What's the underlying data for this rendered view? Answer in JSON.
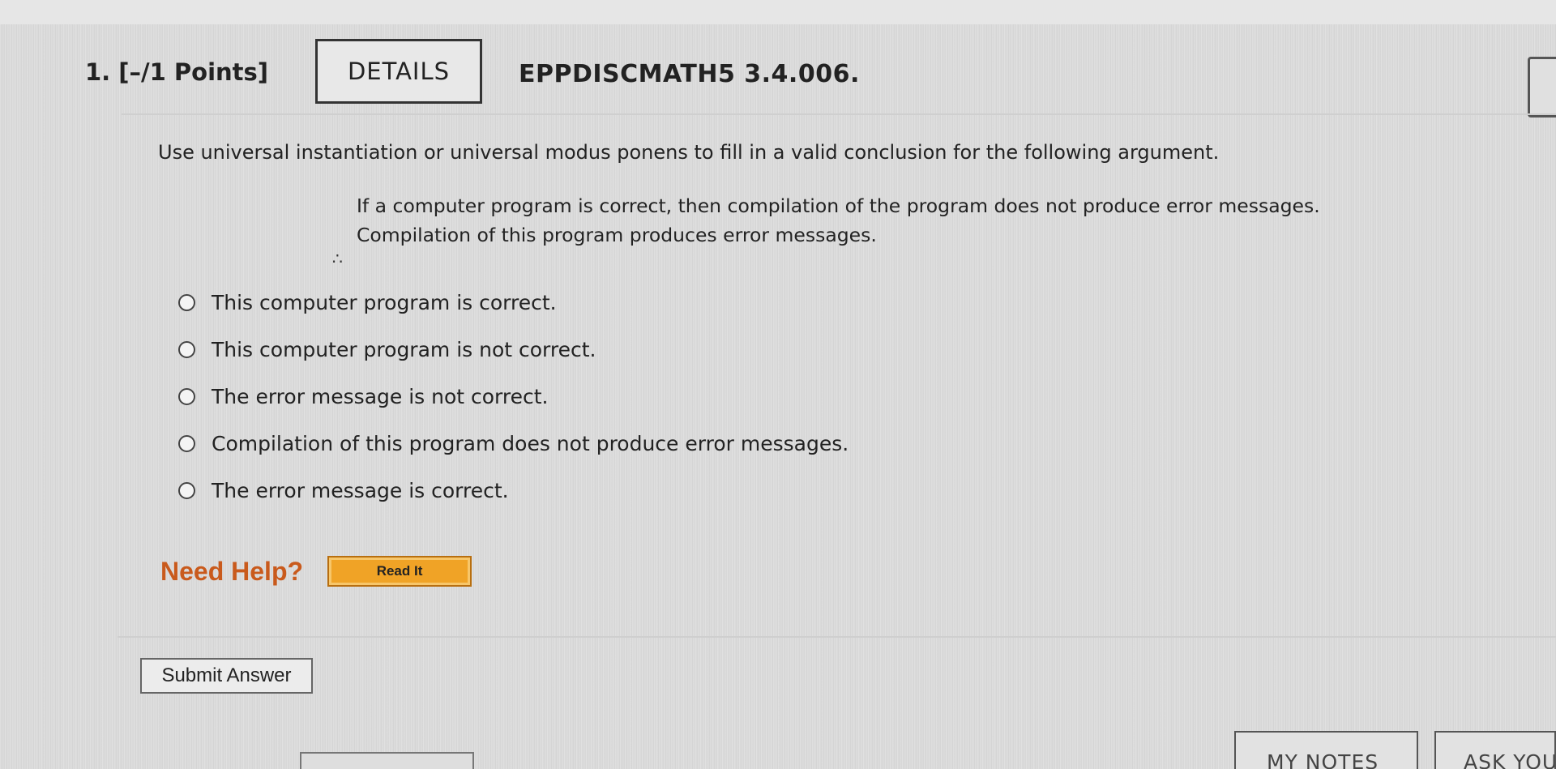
{
  "question": {
    "number_points": "1.  [–/1 Points]",
    "details_label": "DETAILS",
    "code": "EPPDISCMATH5 3.4.006."
  },
  "prompt": "Use universal instantiation or universal modus ponens to fill in a valid conclusion for the following argument.",
  "argument": {
    "premise1": "If a computer program is correct, then compilation of the program does not produce error messages.",
    "premise2": "Compilation of this program produces error messages.",
    "therefore_symbol": "∴"
  },
  "options": [
    {
      "label": "This computer program is correct.",
      "selected": false
    },
    {
      "label": "This computer program is not correct.",
      "selected": false
    },
    {
      "label": "The error message is not correct.",
      "selected": false
    },
    {
      "label": "Compilation of this program does not produce error messages.",
      "selected": false
    },
    {
      "label": "The error message is correct.",
      "selected": false
    }
  ],
  "help": {
    "need_help": "Need Help?",
    "read_it": "Read It"
  },
  "submit_label": "Submit Answer",
  "bottom_tabs": {
    "my_notes": "MY NOTES",
    "ask_your": "ASK YOU"
  },
  "colors": {
    "need_help": "#c95a1c",
    "read_it_bg": "#f0a326"
  }
}
